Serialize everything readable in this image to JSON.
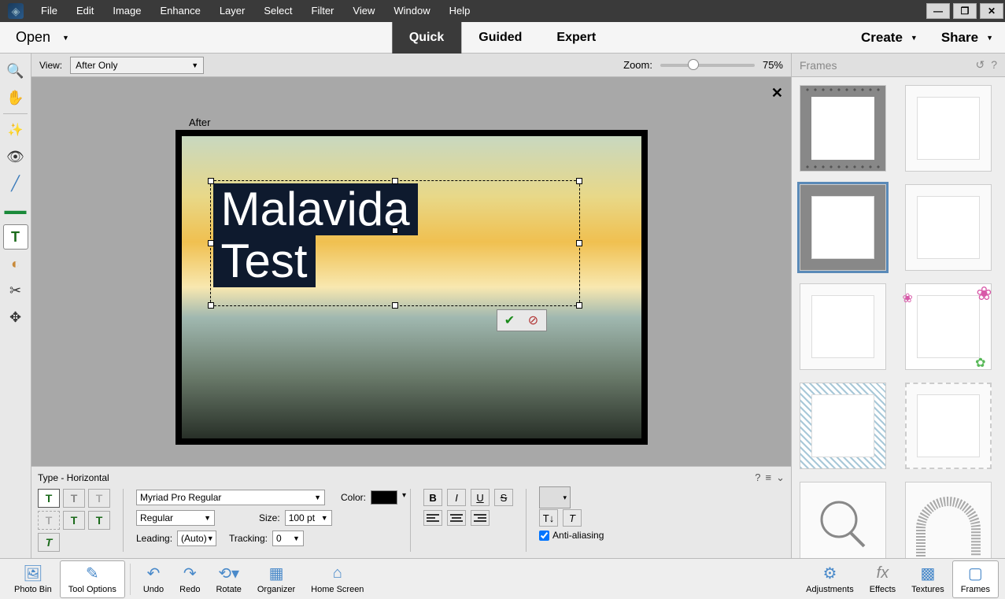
{
  "menu": {
    "items": [
      "File",
      "Edit",
      "Image",
      "Enhance",
      "Layer",
      "Select",
      "Filter",
      "View",
      "Window",
      "Help"
    ]
  },
  "modebar": {
    "open": "Open",
    "tabs": [
      "Quick",
      "Guided",
      "Expert"
    ],
    "active": 0,
    "create": "Create",
    "share": "Share"
  },
  "viewbar": {
    "label": "View:",
    "selected": "After Only",
    "zoom_label": "Zoom:",
    "zoom": "75%"
  },
  "canvas": {
    "after_label": "After",
    "text_line1": "Malavida",
    "text_line2": "Test"
  },
  "tool_options": {
    "title": "Type - Horizontal",
    "font": "Myriad Pro Regular",
    "color_label": "Color:",
    "style": "Regular",
    "size_label": "Size:",
    "size": "100 pt",
    "leading_label": "Leading:",
    "leading": "(Auto)",
    "tracking_label": "Tracking:",
    "tracking": "0",
    "antialias": "Anti-aliasing"
  },
  "frames": {
    "title": "Frames"
  },
  "bottom": {
    "photo_bin": "Photo Bin",
    "tool_options": "Tool Options",
    "undo": "Undo",
    "redo": "Redo",
    "rotate": "Rotate",
    "organizer": "Organizer",
    "home": "Home Screen",
    "adjustments": "Adjustments",
    "effects": "Effects",
    "textures": "Textures",
    "frames": "Frames"
  }
}
